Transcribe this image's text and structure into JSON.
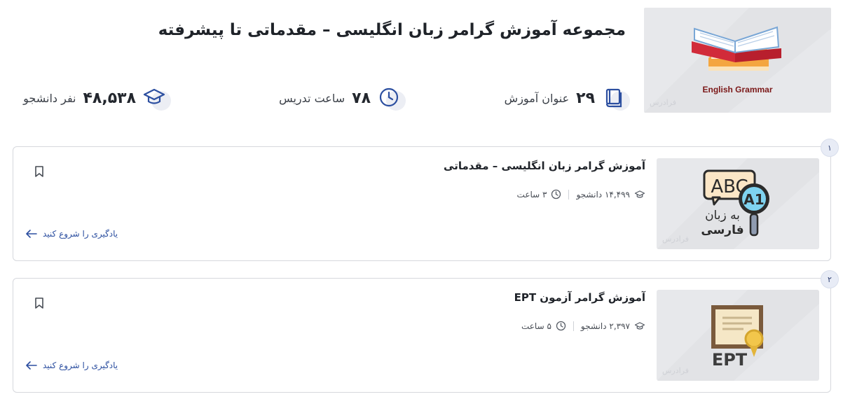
{
  "header": {
    "title": "مجموعه آموزش گرامر زبان انگلیسی – مقدماتی تا پیشرفته",
    "thumbnail": {
      "caption": "English Grammar",
      "watermark": "فرادرس"
    }
  },
  "stats": {
    "courses": {
      "value": "۲۹",
      "label": "عنوان آموزش",
      "icon": "book-icon"
    },
    "hours": {
      "value": "۷۸",
      "label": "ساعت تدریس",
      "icon": "clock-icon"
    },
    "students": {
      "value": "۴۸,۵۳۸",
      "label": "نفر دانشجو",
      "icon": "graduation-cap-icon"
    }
  },
  "courses": [
    {
      "index": "۱",
      "title": "آموزش گرامر زبان انگلیسی – مقدماتی",
      "students": "۱۴,۴۹۹ دانشجو",
      "hours": "۳ ساعت",
      "start_label": "یادگیری را شروع کنید",
      "thumb": {
        "abc": "ABC",
        "level": "A1",
        "line1": "به زبان",
        "line2": "فارسی",
        "watermark": "فرادرس"
      }
    },
    {
      "index": "۲",
      "title": "آموزش گرامر آزمون EPT",
      "students": "۲,۳۹۷ دانشجو",
      "hours": "۵ ساعت",
      "start_label": "یادگیری را شروع کنید",
      "thumb": {
        "label": "EPT",
        "watermark": "فرادرس"
      }
    }
  ],
  "colors": {
    "accent": "#2c4fa0",
    "icon_bubble": "#eceef4",
    "card_border": "#d6d8dd"
  }
}
